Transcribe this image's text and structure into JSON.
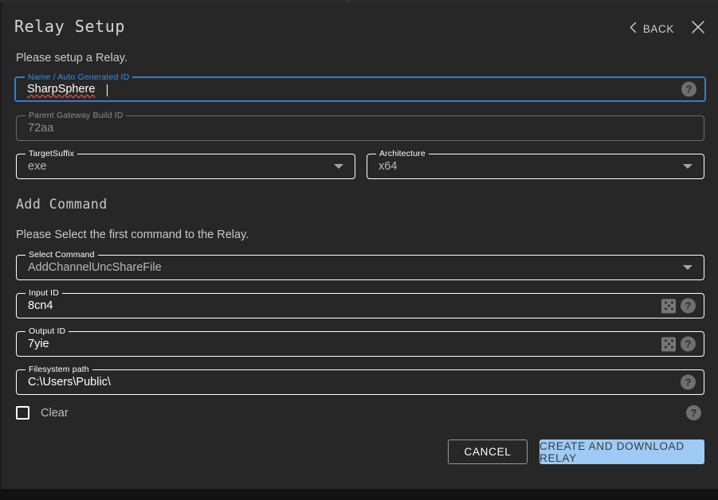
{
  "header": {
    "title": "Relay Setup",
    "back_label": "BACK",
    "back_icon": "chevron-left-icon",
    "close_icon": "close-icon"
  },
  "relay_section": {
    "subtitle": "Please setup a Relay.",
    "fields": {
      "name": {
        "label": "Name / Auto Generated ID",
        "value": "SharpSphere",
        "state": "focused",
        "help_icon": "help-circle-icon"
      },
      "parent_gateway_build_id": {
        "label": "Parent Gateway Build ID",
        "value": "72aa",
        "state": "disabled"
      },
      "target_suffix": {
        "label": "TargetSuffix",
        "value": "exe",
        "state": "select",
        "dropdown_icon": "chevron-down-icon"
      },
      "architecture": {
        "label": "Architecture",
        "value": "x64",
        "state": "select",
        "dropdown_icon": "chevron-down-icon"
      }
    }
  },
  "command_section": {
    "title": "Add  Command",
    "subtitle": "Please Select the first command to the Relay.",
    "fields": {
      "select_command": {
        "label": "Select Command",
        "value": "AddChannelUncShareFile",
        "state": "select",
        "dropdown_icon": "chevron-down-icon"
      },
      "input_id": {
        "label": "Input ID",
        "value": "8cn4",
        "dice_icon": "dice-icon",
        "help_icon": "help-circle-icon"
      },
      "output_id": {
        "label": "Output ID",
        "value": "7yie",
        "dice_icon": "dice-icon",
        "help_icon": "help-circle-icon"
      },
      "filesystem_path": {
        "label": "Filesystem path",
        "value": "C:\\Users\\Public\\",
        "help_icon": "help-circle-icon"
      }
    },
    "clear_checkbox": {
      "label": "Clear",
      "checked": false,
      "help_icon": "help-circle-icon"
    }
  },
  "footer": {
    "cancel_label": "CANCEL",
    "submit_label": "CREATE AND DOWNLOAD RELAY"
  },
  "icons": {
    "help_glyph": "?"
  },
  "colors": {
    "background": "#272727",
    "accent_focus": "#2a7fdd",
    "primary_button": "#9ecbf5",
    "field_border": "#ffffff",
    "disabled": "#8d8d8d",
    "spellcheck_underline": "#e0443e"
  }
}
